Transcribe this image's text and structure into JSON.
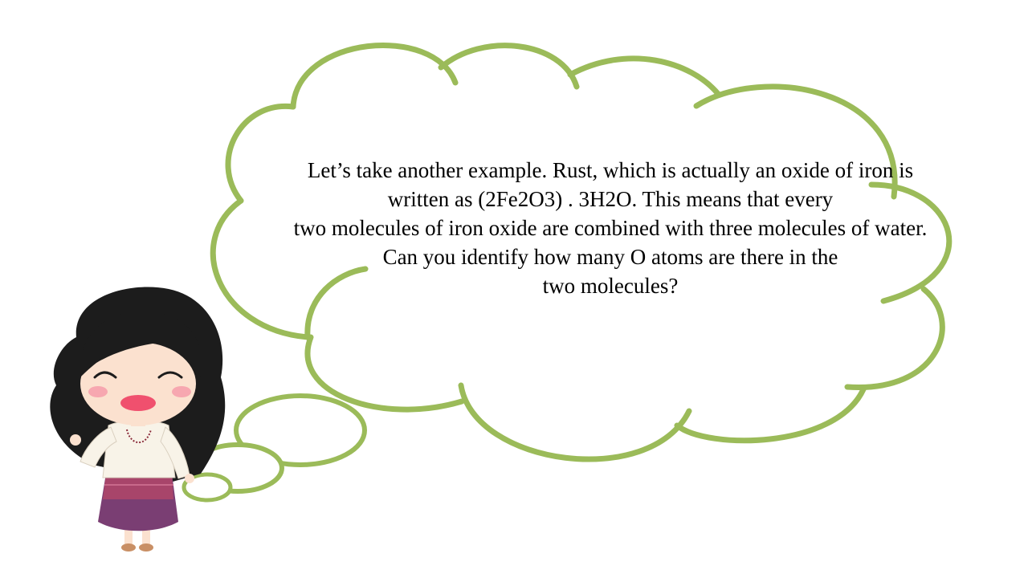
{
  "slide": {
    "lines": [
      "Let’s take another example. Rust, which is actually an oxide of iron is",
      "written as (2Fe2O3) . 3H2O. This means that every",
      "two molecules of iron oxide are combined with three molecules of water.",
      "Can you identify how many O atoms are there in the",
      "two molecules?"
    ]
  },
  "colors": {
    "cloud_stroke": "#9bbb59",
    "hair": "#1c1c1c",
    "skin": "#fbe1cf",
    "blush": "#f7a7b0",
    "mouth": "#f0506e",
    "blouse": "#f8f3e8",
    "skirt_top": "#a8456a",
    "skirt_bottom": "#7a3e73"
  },
  "icons": {
    "thought_cloud": "thought-cloud-icon",
    "character": "girl-character-icon"
  }
}
